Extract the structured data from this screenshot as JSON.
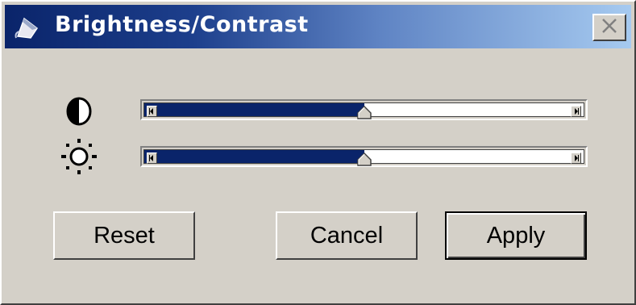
{
  "window": {
    "title": "Brightness/Contrast",
    "title_icon": "paint-bucket-icon",
    "close_icon": "close-icon"
  },
  "controls": {
    "contrast": {
      "icon": "contrast-icon",
      "value_fraction": 0.5
    },
    "brightness": {
      "icon": "brightness-sun-icon",
      "value_fraction": 0.5
    }
  },
  "buttons": {
    "reset": "Reset",
    "cancel": "Cancel",
    "apply": "Apply"
  },
  "colors": {
    "title_gradient_start": "#0a246a",
    "title_gradient_end": "#a6caf0",
    "slider_fill": "#0a246a",
    "face": "#d4d0c8"
  }
}
